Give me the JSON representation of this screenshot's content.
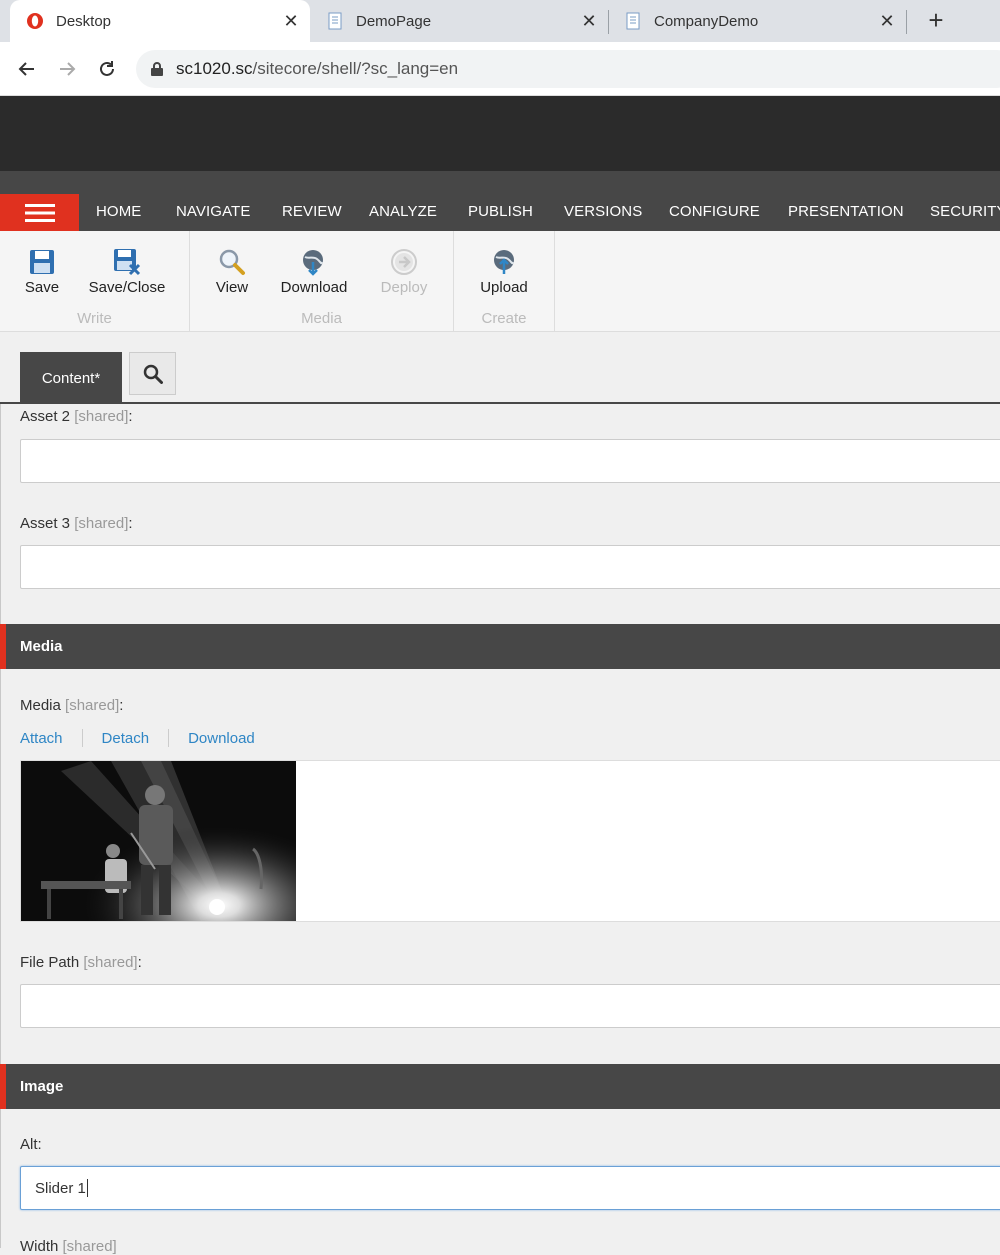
{
  "browser": {
    "tabs": [
      {
        "title": "Desktop",
        "active": true
      },
      {
        "title": "DemoPage",
        "active": false
      },
      {
        "title": "CompanyDemo",
        "active": false
      }
    ],
    "url_host": "sc1020.sc",
    "url_path": "/sitecore/shell/?sc_lang=en"
  },
  "ribbon_tabs": [
    "HOME",
    "NAVIGATE",
    "REVIEW",
    "ANALYZE",
    "PUBLISH",
    "VERSIONS",
    "CONFIGURE",
    "PRESENTATION",
    "SECURITY"
  ],
  "ribbon": {
    "write": {
      "label": "Write",
      "save": "Save",
      "save_close": "Save/Close"
    },
    "media": {
      "label": "Media",
      "view": "View",
      "download": "Download",
      "deploy": "Deploy"
    },
    "create": {
      "label": "Create",
      "upload": "Upload"
    }
  },
  "editor_tabs": {
    "content": "Content*"
  },
  "fields": {
    "asset2": {
      "label": "Asset 2",
      "shared": "[shared]",
      "colon": ":"
    },
    "asset3": {
      "label": "Asset 3",
      "shared": "[shared]",
      "colon": ":"
    },
    "media_section": "Media",
    "media": {
      "label": "Media",
      "shared": "[shared]",
      "colon": ":"
    },
    "media_links": {
      "attach": "Attach",
      "detach": "Detach",
      "download": "Download"
    },
    "file_path": {
      "label": "File Path",
      "shared": "[shared]",
      "colon": ":"
    },
    "image_section": "Image",
    "alt": {
      "label": "Alt:",
      "value": "Slider 1"
    },
    "width": {
      "label": "Width",
      "shared": "[shared]"
    }
  },
  "colors": {
    "accent": "#e0311f",
    "dark": "#474747",
    "link": "#2f86c5"
  }
}
